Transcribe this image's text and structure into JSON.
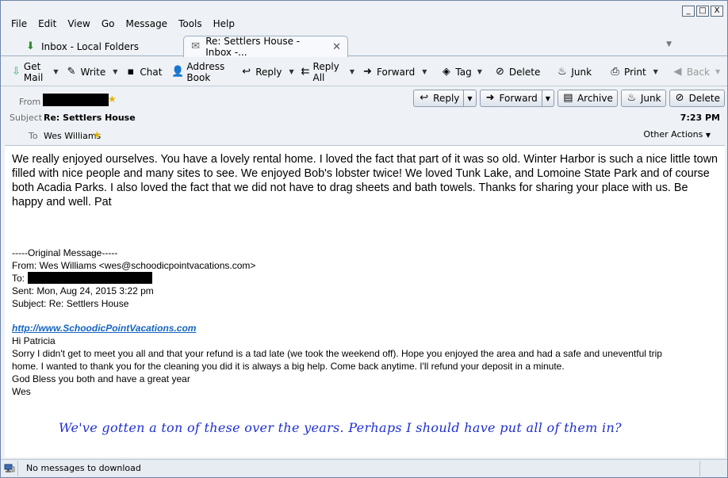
{
  "window_controls": [
    "_",
    "□",
    "X"
  ],
  "menubar": [
    "File",
    "Edit",
    "View",
    "Go",
    "Message",
    "Tools",
    "Help"
  ],
  "tabs": [
    {
      "label": "Inbox - Local Folders",
      "icon": "inbox-download-icon"
    },
    {
      "label": "Re: Settlers House - Inbox -...",
      "icon": "mail-envelope-icon"
    }
  ],
  "toolbar": {
    "get_mail": "Get Mail",
    "write": "Write",
    "chat": "Chat",
    "address_book": "Address Book",
    "reply": "Reply",
    "reply_all": "Reply All",
    "forward": "Forward",
    "tag": "Tag",
    "delete": "Delete",
    "junk": "Junk",
    "print": "Print",
    "back": "Back"
  },
  "header": {
    "from_label": "From",
    "subject_label": "Subject",
    "subject": "Re: Settlers House",
    "to_label": "To",
    "to": "Wes Williams",
    "time": "7:23 PM",
    "other_actions": "Other Actions",
    "buttons": {
      "reply": "Reply",
      "forward": "Forward",
      "archive": "Archive",
      "junk": "Junk",
      "delete": "Delete"
    }
  },
  "body": {
    "reply_text": "We really enjoyed ourselves. You have a lovely rental home. I loved the fact that part of it was so old. Winter Harbor is such a nice little town  filled with nice people and many sites to see.  We enjoyed Bob's lobster twice!  We loved Tunk Lake, and Lomoine State Park and of course both Acadia Parks.  I also loved the fact that we did not have to drag sheets and bath towels. Thanks for sharing your place with us. Be happy and well.  Pat",
    "original_header": "-----Original Message-----",
    "orig_from": "From: Wes Williams <wes@schoodicpointvacations.com>",
    "orig_to_label": "To:",
    "orig_sent": "Sent: Mon, Aug 24, 2015 3:22 pm",
    "orig_subject": "Subject: Re: Settlers House",
    "link": "http://www.SchoodicPointVacations.com",
    "greeting": "Hi Patricia",
    "orig_line1": "Sorry I didn't get to meet you all and that your refund is a tad late (we took the weekend off).  Hope you enjoyed the area and had a safe and uneventful trip",
    "orig_line2": "home.   I wanted to thank you for the cleaning you did it is always a big help.   Come back anytime.   I'll refund your deposit in a minute.",
    "closing": "God Bless you both and have a great year",
    "signature": "Wes",
    "handwritten_note": "We've gotten a ton of these over the years. Perhaps I should have put all of them in?"
  },
  "status": {
    "text": "No messages to download"
  },
  "colors": {
    "link": "#1565c0",
    "handwriting": "#1f2fd0",
    "star": "#e2b400"
  }
}
